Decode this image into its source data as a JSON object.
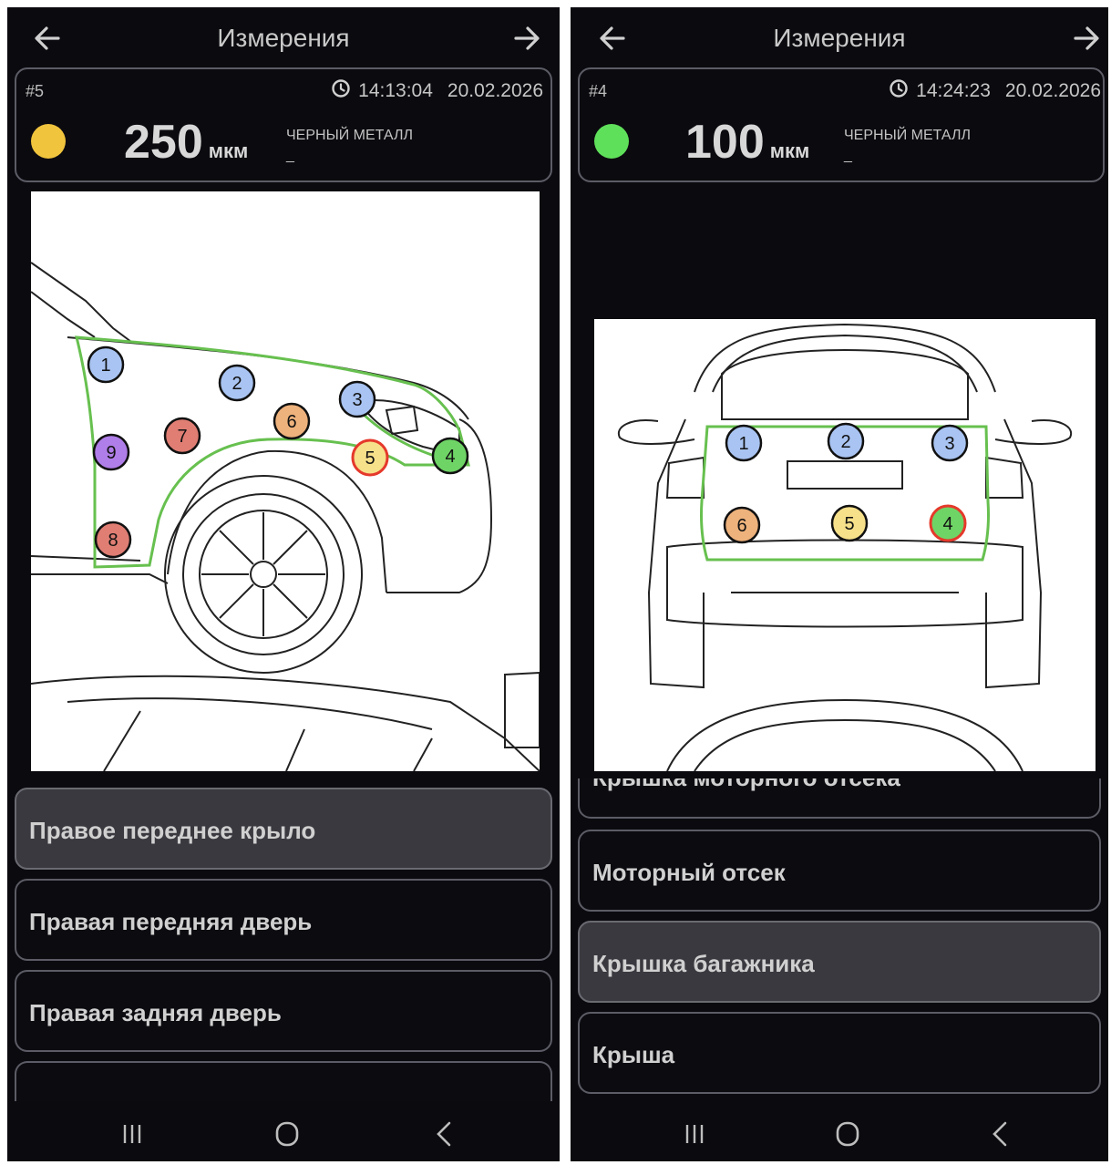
{
  "screens": [
    {
      "title": "Измерения",
      "record_number": "#5",
      "time": "14:13:04",
      "date": "20.02.2026",
      "value": "250",
      "unit": "мкм",
      "metal_type": "ЧЕРНЫЙ МЕТАЛЛ",
      "metal_sub": "_",
      "status_color": "#f0c43c",
      "diagram_view": "right-front-fender",
      "points": [
        {
          "label": "1",
          "color": "#a9c4f2",
          "highlight": false
        },
        {
          "label": "2",
          "color": "#a9c4f2",
          "highlight": false
        },
        {
          "label": "3",
          "color": "#a9c4f2",
          "highlight": false
        },
        {
          "label": "4",
          "color": "#6fd466",
          "highlight": false
        },
        {
          "label": "5",
          "color": "#f6e08a",
          "highlight": true
        },
        {
          "label": "6",
          "color": "#eeb27c",
          "highlight": false
        },
        {
          "label": "7",
          "color": "#e07e74",
          "highlight": false
        },
        {
          "label": "8",
          "color": "#e07e74",
          "highlight": false
        },
        {
          "label": "9",
          "color": "#b07ee8",
          "highlight": false
        }
      ],
      "list": [
        {
          "label": "Правое переднее крыло",
          "selected": true
        },
        {
          "label": "Правая передняя дверь",
          "selected": false
        },
        {
          "label": "Правая задняя дверь",
          "selected": false
        },
        {
          "label": "",
          "selected": false
        }
      ]
    },
    {
      "title": "Измерения",
      "record_number": "#4",
      "time": "14:24:23",
      "date": "20.02.2026",
      "value": "100",
      "unit": "мкм",
      "metal_type": "ЧЕРНЫЙ МЕТАЛЛ",
      "metal_sub": "_",
      "status_color": "#5fe05a",
      "diagram_view": "rear-trunk-lid",
      "points": [
        {
          "label": "1",
          "color": "#a9c4f2",
          "highlight": false
        },
        {
          "label": "2",
          "color": "#a9c4f2",
          "highlight": false
        },
        {
          "label": "3",
          "color": "#a9c4f2",
          "highlight": false
        },
        {
          "label": "4",
          "color": "#6fd466",
          "highlight": true
        },
        {
          "label": "5",
          "color": "#f6e08a",
          "highlight": false
        },
        {
          "label": "6",
          "color": "#eeb27c",
          "highlight": false
        }
      ],
      "list": [
        {
          "label": "Крышка моторного отсека",
          "selected": false
        },
        {
          "label": "Моторный отсек",
          "selected": false
        },
        {
          "label": "Крышка багажника",
          "selected": true
        },
        {
          "label": "Крыша",
          "selected": false
        }
      ]
    }
  ],
  "colors": {
    "background": "#0b0a0f",
    "card_border": "#5c5c66",
    "selected_item": "#3a393f",
    "outline_green": "#67c04f",
    "highlight_ring": "#e5392b"
  },
  "icons": {
    "back": "arrow-left-icon",
    "forward": "arrow-right-icon",
    "clock": "clock-icon",
    "recents": "recents-icon",
    "home": "home-icon",
    "system_back": "chevron-left-icon"
  }
}
